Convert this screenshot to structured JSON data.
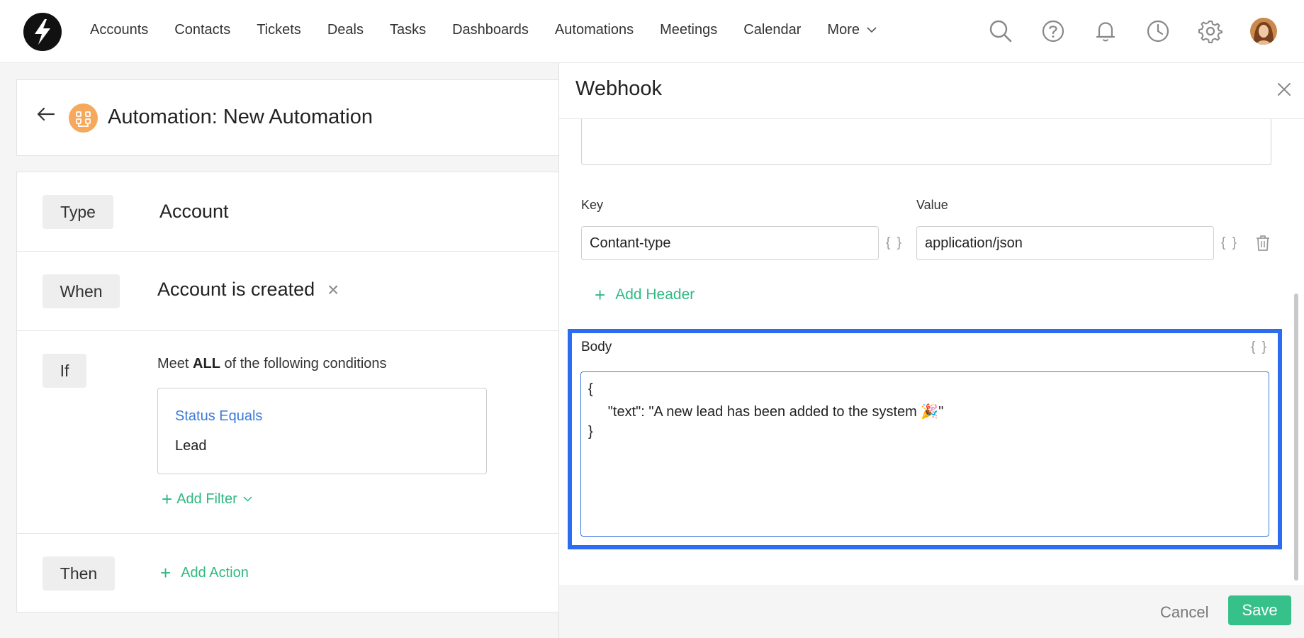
{
  "nav": {
    "items": [
      "Accounts",
      "Contacts",
      "Tickets",
      "Deals",
      "Tasks",
      "Dashboards",
      "Automations",
      "Meetings",
      "Calendar"
    ],
    "more_label": "More"
  },
  "icons": {
    "logo": "app-logo",
    "search": "search-icon",
    "help": "help-icon",
    "notifications": "bell-icon",
    "recent": "clock-icon",
    "settings": "gear-icon",
    "user": "avatar"
  },
  "page": {
    "title": "Automation: New Automation"
  },
  "form": {
    "type_label": "Type",
    "type_value": "Account",
    "when_label": "When",
    "when_value": "Account is created",
    "if_label": "If",
    "meet_prefix": "Meet ",
    "meet_bold": "ALL",
    "meet_suffix": " of the following conditions",
    "condition_label": "Status Equals",
    "condition_value": "Lead",
    "add_filter_label": "Add Filter",
    "then_label": "Then",
    "add_action_label": "Add Action"
  },
  "webhook": {
    "title": "Webhook",
    "key_label": "Key",
    "value_label": "Value",
    "header_key": "Contant-type",
    "header_value": "application/json",
    "braces": "{ }",
    "add_header_label": "Add Header",
    "body_label": "Body",
    "body_lines": [
      "{",
      "     \"text\": \"A new lead has been added to the system 🎉\"",
      "}"
    ],
    "cancel_label": "Cancel",
    "save_label": "Save"
  },
  "colors": {
    "accent_green": "#2fb982",
    "link_blue": "#3d7bd9",
    "highlight_blue": "#2c6cf0",
    "automation_orange": "#f6a85c"
  }
}
